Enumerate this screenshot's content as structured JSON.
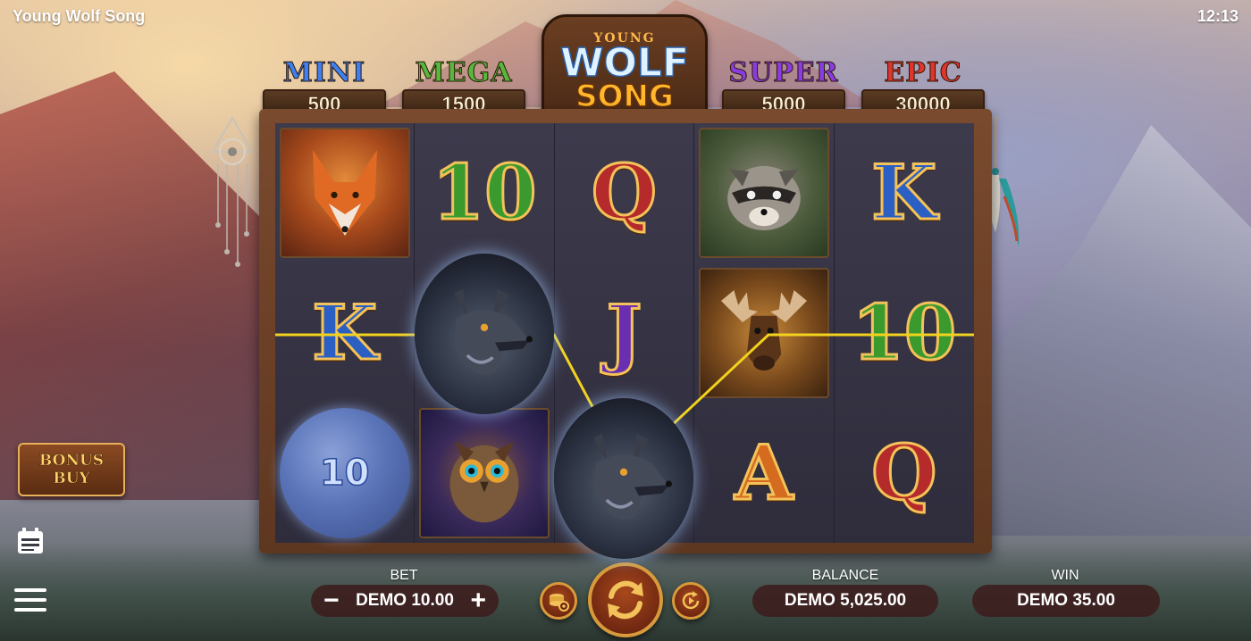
{
  "app": {
    "title": "Young Wolf Song",
    "time": "12:13"
  },
  "logo": {
    "line1": "YOUNG",
    "line2": "WOLF",
    "line3": "SONG"
  },
  "jackpots": [
    {
      "name": "MINI",
      "value": "500",
      "color": "#3f7ff0"
    },
    {
      "name": "MEGA",
      "value": "1500",
      "color": "#57b83c"
    },
    {
      "name": "SUPER",
      "value": "5000",
      "color": "#8a3ce0"
    },
    {
      "name": "EPIC",
      "value": "30000",
      "color": "#e0352c"
    }
  ],
  "reels": [
    [
      {
        "symbol": "fox",
        "icon": "fox-icon"
      },
      {
        "symbol": "K"
      },
      {
        "symbol": "moon",
        "value": "10"
      }
    ],
    [
      {
        "symbol": "10"
      },
      {
        "symbol": "wolf",
        "icon": "wolf-icon"
      },
      {
        "symbol": "owl",
        "icon": "owl-icon"
      }
    ],
    [
      {
        "symbol": "Q"
      },
      {
        "symbol": "J"
      },
      {
        "symbol": "wolf",
        "icon": "wolf-icon"
      }
    ],
    [
      {
        "symbol": "raccoon",
        "icon": "raccoon-icon"
      },
      {
        "symbol": "moose",
        "icon": "moose-icon"
      },
      {
        "symbol": "A"
      }
    ],
    [
      {
        "symbol": "K"
      },
      {
        "symbol": "10"
      },
      {
        "symbol": "Q"
      }
    ]
  ],
  "controls": {
    "bonus_buy": "BONUS\nBUY",
    "bet_label": "BET",
    "bet_value": "DEMO 10.00",
    "minus": "−",
    "plus": "+",
    "balance_label": "BALANCE",
    "balance_value": "DEMO 5,025.00",
    "win_label": "WIN",
    "win_value": "DEMO 35.00"
  },
  "colors": {
    "payline": "#f2d21e",
    "frame_wood": "#6b3e22",
    "pill_bg": "#3c1c1c"
  }
}
